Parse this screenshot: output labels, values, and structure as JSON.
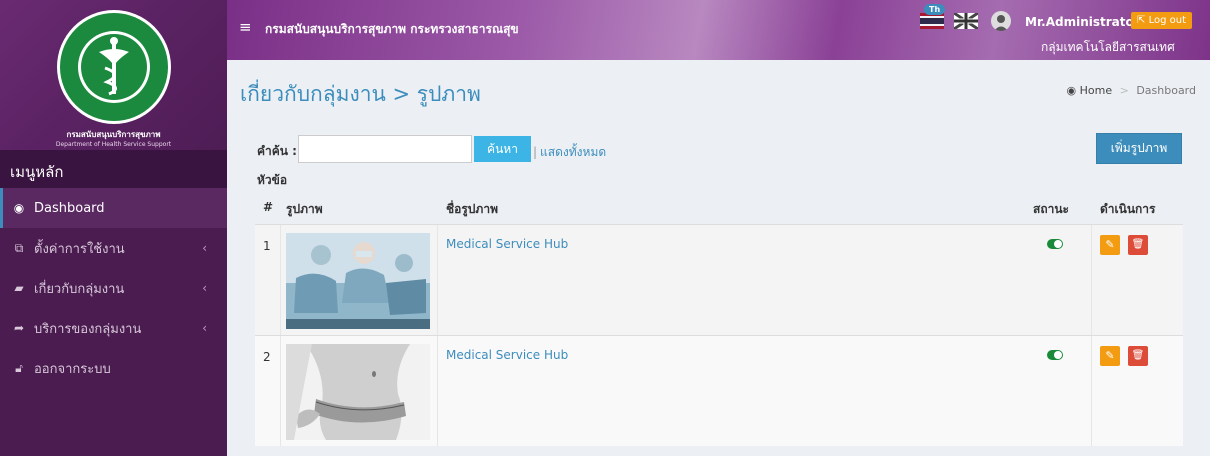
{
  "sidebar": {
    "org_th": "กรมสนับสนุนบริการสุขภาพ",
    "org_en": "Department of Health Service Support",
    "seal_text_top": "กระทรวงสาธารณสุข",
    "seal_text_bottom": "MINISTRY OF PUBLIC HEALTH",
    "menu_header": "เมนูหลัก",
    "items": [
      {
        "label": "Dashboard",
        "icon": "dashboard-icon"
      },
      {
        "label": "ตั้งค่าการใช้งาน",
        "icon": "settings-copy-icon"
      },
      {
        "label": "เกี่ยวกับกลุ่มงาน",
        "icon": "book-icon"
      },
      {
        "label": "บริการของกลุ่มงาน",
        "icon": "share-arrow-icon"
      },
      {
        "label": "ออกจากระบบ",
        "icon": "unlock-icon"
      }
    ]
  },
  "topbar": {
    "title": "กรมสนับสนุนบริการสุขภาพ กระทรวงสาธารณสุข",
    "lang_badge": "Th",
    "user_name": "Mr.Administrator",
    "logout_label": "Log out",
    "department": "กลุ่มเทคโนโลยีสารสนเทศ"
  },
  "page": {
    "title": "เกี่ยวกับกลุ่มงาน > รูปภาพ",
    "breadcrumb_home": "Home",
    "breadcrumb_current": "Dashboard"
  },
  "search": {
    "label": "คำค้น :",
    "value": "",
    "button": "ค้นหา",
    "show_all": "แสดงทั้งหมด",
    "topic_label": "หัวข้อ"
  },
  "add_button": "เพิ่มรูปภาพ",
  "table": {
    "headers": {
      "num": "#",
      "image": "รูปภาพ",
      "name": "ชื่อรูปภาพ",
      "status": "สถานะ",
      "action": "ดำเนินการ"
    },
    "rows": [
      {
        "num": "1",
        "name": "Medical Service Hub",
        "status_on": true
      },
      {
        "num": "2",
        "name": "Medical Service Hub",
        "status_on": true
      }
    ]
  },
  "colors": {
    "sidebar": "#4a1c4f",
    "accent": "#3c8dbc",
    "warning": "#f39c12",
    "danger": "#dd4b39"
  }
}
